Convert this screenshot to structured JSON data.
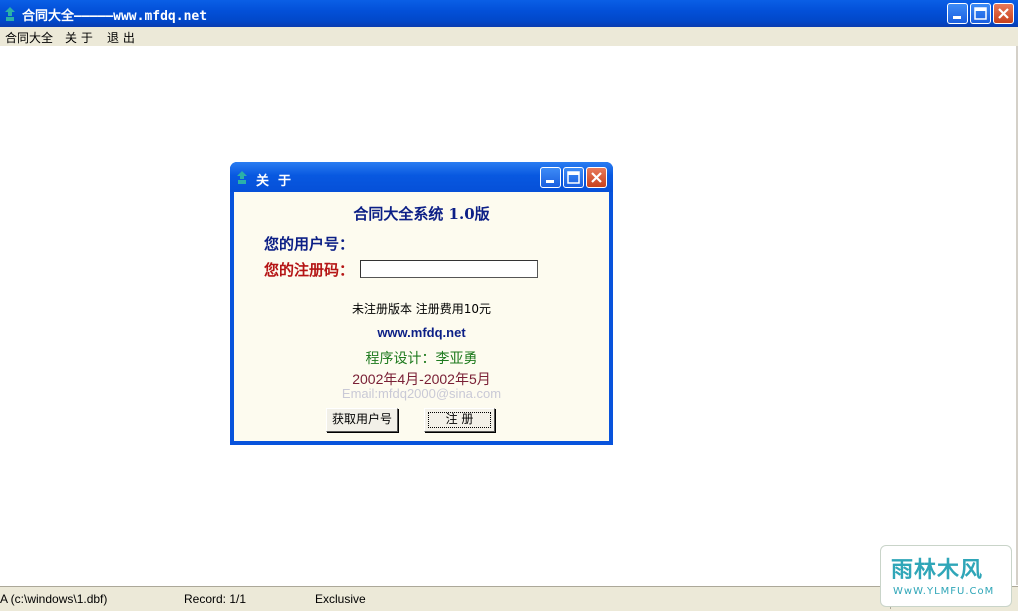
{
  "window": {
    "title": "合同大全—————www.mfdq.net",
    "icon": "app-icon",
    "buttons": [
      "minimize-icon",
      "maximize-icon",
      "close-icon"
    ]
  },
  "menu": {
    "items": [
      "合同大全",
      "关 于",
      "退 出"
    ]
  },
  "dialog": {
    "title": "关  于",
    "heading": "合同大全系统 1.0版",
    "user_id_label": "您的用户号：",
    "reg_code_label": "您的注册码：",
    "reg_code_value": "",
    "unregistered_text": "未注册版本 注册费用10元",
    "website": "www.mfdq.net",
    "designer": "程序设计：李亚勇",
    "dates": "2002年4月-2002年5月",
    "email": "Email:mfdq2000@sina.com",
    "get_user_button": "获取用户号",
    "register_button": "注 册"
  },
  "statusbar": {
    "table": "A (c:\\windows\\1.dbf)",
    "record": "Record: 1/1",
    "mode": "Exclusive"
  },
  "watermark": {
    "main": "雨林木风",
    "sub": "WwW.YLMFU.CoM"
  },
  "colors": {
    "title_blue": "#0853dc",
    "heading_navy": "#0c1f86",
    "reg_label_red": "#b51515",
    "designer_green": "#1e7a1e",
    "dates_maroon": "#7a2036",
    "dialog_bg": "#fdfbef"
  }
}
